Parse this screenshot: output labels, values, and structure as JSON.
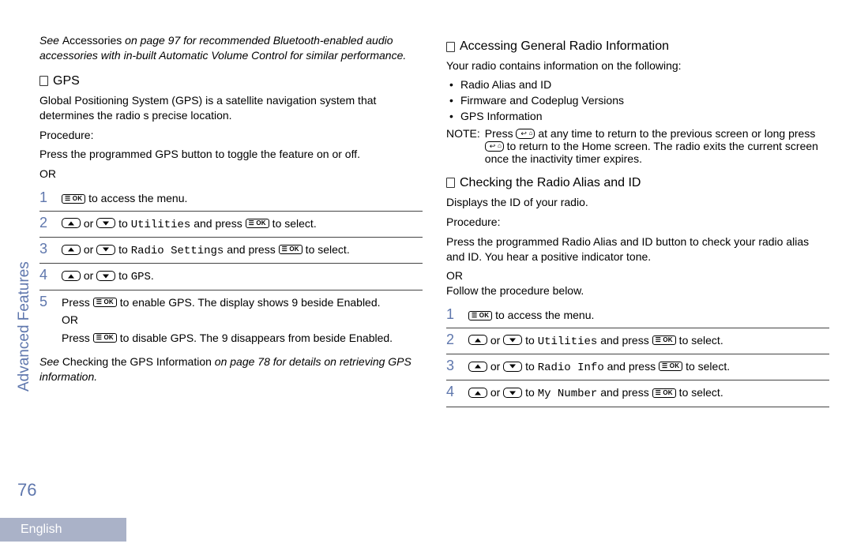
{
  "sidebar": {
    "tab": "Advanced Features"
  },
  "page_number": "76",
  "footer": {
    "language": "English"
  },
  "left": {
    "intro": {
      "part1": "See ",
      "accessories": "Accessories",
      "part2": "  on page 97 for recommended Bluetooth-enabled audio accessories with in-built Automatic Volume Control for similar performance."
    },
    "heading_gps": "GPS",
    "gps_desc": "Global Positioning System (GPS) is a satellite navigation system that determines the radio s precise location.",
    "procedure_label": "Procedure:",
    "gps_press": "Press the programmed GPS button to toggle the feature on or off.",
    "or_label": "OR",
    "steps": [
      {
        "num": "1",
        "post_key": " to access the menu."
      },
      {
        "num": "2",
        "mid": " or ",
        "to": " to ",
        "target": "Utilities",
        "and": " and press ",
        "post": " to select."
      },
      {
        "num": "3",
        "mid": " or ",
        "to": " to ",
        "target": "Radio Settings",
        "and": " and press ",
        "post": " to select."
      },
      {
        "num": "4",
        "mid": " or ",
        "to": " to ",
        "target": "GPS",
        "post": "."
      },
      {
        "num": "5",
        "press": "Press ",
        "enable": " to enable GPS. The display shows  9 beside Enabled.",
        "or": "OR",
        "press2": "Press ",
        "disable": " to disable GPS. The  9 disappears from beside Enabled."
      }
    ],
    "see_note": {
      "part1": "See ",
      "ref": "Checking the GPS Information",
      "part2": "   on page 78 for details on retrieving GPS information."
    }
  },
  "right": {
    "heading_gen": "Accessing General Radio Information",
    "gen_intro": "Your radio contains information on the following:",
    "bullets": [
      "Radio Alias and ID",
      "Firmware and Codeplug Versions",
      "GPS Information"
    ],
    "note": {
      "label": "NOTE:",
      "p1a": "Press ",
      "p1b": " at any time to return to the previous screen or long press ",
      "p1c": " to return to the Home screen. The radio exits the current screen once the inactivity timer expires."
    },
    "heading_check": "Checking the Radio Alias and ID",
    "check_intro": "Displays the ID of your radio.",
    "procedure_label": "Procedure:",
    "check_press": "Press the programmed Radio Alias and ID button to check your radio alias and ID. You hear a positive indicator tone.",
    "or_label": "OR",
    "follow": "Follow the procedure below.",
    "steps": [
      {
        "num": "1",
        "post_key": " to access the menu."
      },
      {
        "num": "2",
        "mid": " or ",
        "to": " to ",
        "target": "Utilities",
        "and": " and press ",
        "post": " to select."
      },
      {
        "num": "3",
        "mid": " or ",
        "to": " to ",
        "target": "Radio Info",
        "and": " and press ",
        "post": " to select."
      },
      {
        "num": "4",
        "mid": " or ",
        "to": " to ",
        "target": "My Number",
        "and": " and press ",
        "post": " to select."
      }
    ]
  }
}
